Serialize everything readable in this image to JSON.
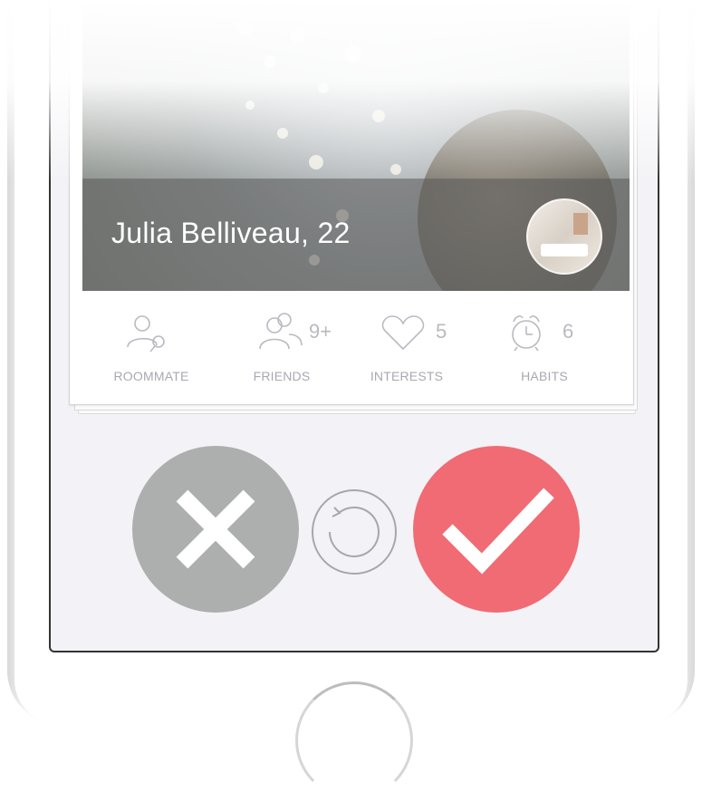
{
  "profile": {
    "name_age": "Julia Belliveau, 22"
  },
  "stats": [
    {
      "icon": "roommate-search-icon",
      "count": "",
      "label": "ROOMMATE"
    },
    {
      "icon": "friends-icon",
      "count": "9+",
      "label": "FRIENDS"
    },
    {
      "icon": "heart-icon",
      "count": "5",
      "label": "INTERESTS"
    },
    {
      "icon": "alarm-clock-icon",
      "count": "6",
      "label": "HABITS"
    }
  ],
  "actions": {
    "reject_icon": "x-icon",
    "undo_icon": "undo-icon",
    "accept_icon": "checkmark-icon"
  },
  "colors": {
    "accept": "#f06b73",
    "reject": "#adaeae",
    "screen_bg": "#f3f2f6",
    "stat_text": "#a8a8b2"
  }
}
